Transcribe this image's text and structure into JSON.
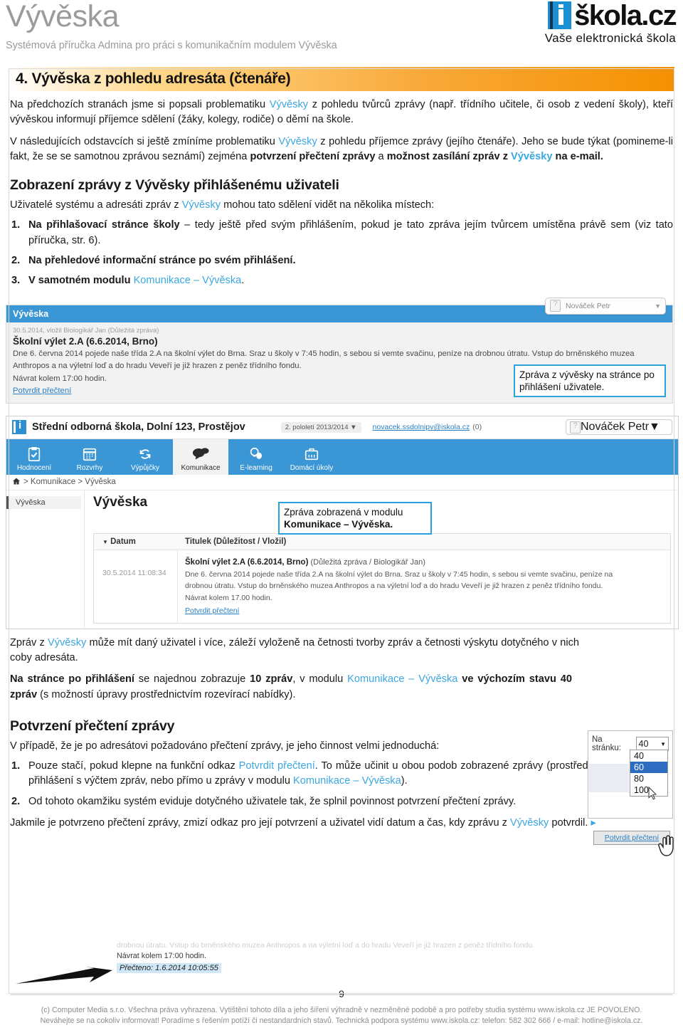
{
  "header": {
    "title": "Vývěska",
    "subtitle": "Systémová příručka Admina pro práci s komunikačním modulem Vývěska",
    "logo_text": "škola.cz",
    "logo_tagline": "Vaše elektronická škola",
    "logo_color": "#1a8fd4"
  },
  "section": {
    "heading": "4. Vývěska z pohledu adresáta (čtenáře)",
    "accent_color": "#f59100"
  },
  "intro": {
    "p1_a": "Na předchozích stranách jsme si popsali problematiku ",
    "p1_link": "Vývěsky",
    "p1_b": " z pohledu tvůrců zprávy (např. třídního učitele, či osob z vedení školy), kteří vývěskou informují příjemce sdělení (žáky, kolegy, rodiče) o děmí na škole.",
    "p2_a": "V následujících odstavcích si ještě zmíníme problematiku ",
    "p2_link": "Vývěsky",
    "p2_b": " z pohledu příjemce zprávy (jejího čtenáře). Jeho se bude týkat (pomineme-li fakt, že se se samotnou zprávou seznámí) zejména ",
    "p2_bold1": "potvrzení přečtení zprávy",
    "p2_c": " a ",
    "p2_bold2": "možnost zasílání zpráv z ",
    "p2_link2": "Vývěsky",
    "p2_bold3": " na e-mail."
  },
  "display_section": {
    "heading": "Zobrazení zprávy z Vývěsky přihlášenému uživateli",
    "lead_a": "Uživatelé systému a adresáti zpráv z ",
    "lead_link": "Vývěsky",
    "lead_b": " mohou tato sdělení vidět na několika místech:",
    "items": [
      {
        "num": "1.",
        "bold": "Na přihlašovací stránce školy",
        "rest": " – tedy ještě před svým přihlášením, pokud je tato zpráva jejím tvůrcem umístěna právě sem (viz tato příručka, str. 6)."
      },
      {
        "num": "2.",
        "bold": "Na přehledové informační stránce po svém přihlášení.",
        "rest": ""
      },
      {
        "num": "3.",
        "bold": "V samotném modulu ",
        "link": "Komunikace – Vývěska",
        "rest": "."
      }
    ]
  },
  "screenshot1": {
    "user_chip": {
      "name": "Nováček Petr",
      "caret": "▼",
      "avatar_icon": "avatar-placeholder-icon"
    },
    "panel_title": "Vývěska",
    "meta": "30.5.2014, vložil Biologikář Jan (Důležitá zpráva)",
    "subject": "Školní výlet 2.A (6.6.2014, Brno)",
    "body_line1": "Dne 6. června 2014 pojede naše třída 2.A na školní výlet do Brna. Sraz u školy v 7:45 hodin, s sebou si vemte svačinu, peníze na drobnou útratu. Vstup do brněnského muzea",
    "body_line2": "Anthropos a na výletní loď a do hradu Veveří je již hrazen z peněz třídního fondu.",
    "body_line3": "Návrat kolem 17:00 hodin.",
    "confirm_link": "Potvrdit přečtení",
    "callout": "Zpráva z vývěsky na stránce po přihlášení uživatele."
  },
  "screenshot2": {
    "school_name": "Střední odborná škola, Dolní 123, Prostějov",
    "term": "2. pololetí 2013/2014",
    "term_caret": "▼",
    "mail": "novacek.ssdolnipv@iskola.cz",
    "mail_count": "(0)",
    "user_chip": {
      "name": "Nováček Petr",
      "caret": "▼"
    },
    "nav": [
      {
        "label": "Hodnocení",
        "icon": "clipboard-check-icon",
        "active": false
      },
      {
        "label": "Rozvrhy",
        "icon": "calendar-icon",
        "active": false
      },
      {
        "label": "Výpůjčky",
        "icon": "refresh-cycle-icon",
        "active": false
      },
      {
        "label": "Komunikace",
        "icon": "speech-bubbles-icon",
        "active": true
      },
      {
        "label": "E-learning",
        "icon": "bulb-mouse-icon",
        "active": false
      },
      {
        "label": "Domácí úkoly",
        "icon": "briefcase-icon",
        "active": false
      }
    ],
    "breadcrumb_home_icon": "home-icon",
    "breadcrumb": "> Komunikace > Vývěska",
    "sidebar_item": "Vývěska",
    "page_title": "Vývěska",
    "table": {
      "col_date": "Datum",
      "col_date_sort_icon": "sort-descending-icon",
      "col_title": "Titulek (Důležitost / Vložil)",
      "rows": [
        {
          "date": "30.5.2014 11:08:34",
          "title": "Školní výlet 2.A (6.6.2014, Brno)",
          "meta": " (Důležitá zpráva / Biologikář Jan)",
          "text_line1": "Dne 6. června 2014 pojede naše třída 2.A na školní výlet do Brna. Sraz u školy v 7:45 hodin, s sebou si vemte svačinu, peníze na",
          "text_line2": "drobnou útratu. Vstup do brněnského muzea Anthropos a na výletní loď a do hradu Veveří je již hrazen z peněz třídního fondu.",
          "text_line3": "Návrat kolem 17.00 hodin.",
          "link": "Potvrdit přečtení"
        }
      ]
    },
    "callout_line1": "Zpráva zobrazená v modulu",
    "callout_line2": "Komunikace – Vývěska."
  },
  "middle_text": {
    "p1_a": "Zpráv z ",
    "p1_link": "Vývěsky",
    "p1_b": " může mít daný uživatel i více, záleží vyloženě na četnosti tvorby zpráv a četnosti výskytu dotyčného v nich coby adresáta.",
    "p2_bold1": "Na stránce po přihlášení",
    "p2_a": " se najednou zobrazuje ",
    "p2_bold2": "10 zpráv",
    "p2_b": ", v modulu ",
    "p2_link": "Komunikace – Vývěska",
    "p2_bold3": " ve výchozím stavu 40 zpráv",
    "p2_c": " (s možností úpravy prostřednictvím rozevírací nabídky)."
  },
  "dropdown_widget": {
    "label": "Na stránku:",
    "selected": "40",
    "caret": "▼",
    "options": [
      "40",
      "60",
      "80",
      "100"
    ],
    "highlighted": "60",
    "cursor_icon": "mouse-cursor-icon"
  },
  "confirm_section": {
    "heading": "Potvrzení přečtení zprávy",
    "lead": "V případě, že je po adresátovi požadováno přečtení zprávy, je jeho činnost velmi jednoduchá:",
    "items": [
      {
        "num": "1.",
        "a": "Pouze stačí, pokud klepne na funkční odkaz ",
        "link1": "Potvrdit přečtení",
        "b": ". To může učinit u obou podob zobrazené zprávy (prostřednictvím stránky po přihlášení s výčtem zpráv, nebo přímo u zprávy v modulu ",
        "link2": "Komunikace – Vývěska",
        "c": ")."
      },
      {
        "num": "2.",
        "a": "Od tohoto okamžiku systém eviduje dotyčného uživatele tak, že splnil povinnost potvrzení přečtení zprávy.",
        "link1": "",
        "b": "",
        "link2": "",
        "c": ""
      }
    ],
    "closing_a": "Jakmile je potvrzeno přečtení zprávy, zmizí odkaz pro její potvrzení a uživatel vidí datum a čas, kdy zprávu z ",
    "closing_link": "Vývěsky",
    "closing_b": " potvrdil. ",
    "closing_marker": "▸"
  },
  "confirm_button_widget": {
    "label": "Potvrdit přečtení",
    "cursor_icon": "hand-pointer-icon"
  },
  "screenshot3": {
    "faded_text": "drobnou útratu. Vstup do brněnského muzea Anthropos a na výletní loď a do hradu Veveří je již hrazen z peněz třídního fondu.",
    "line": "Návrat kolem 17:00 hodin.",
    "read_stamp": "Přečteno: 1.6.2014 10:05:55",
    "arrow_icon": "black-arrow-icon"
  },
  "footer": {
    "page_number": "9",
    "line1": "(c) Computer Media s.r.o. Všechna práva vyhrazena. Vytištění tohoto díla a jeho šíření výhradně v nezměněné podobě a pro potřeby studia systému www.iskola.cz JE POVOLENO.",
    "line2": "Neváhejte se na cokoliv informovat! Poradíme s řešením potíží či nestandardních stavů. Technická podpora systému www.iskola.cz: telefon: 582 302 666 / e-mail: hotline@iskola.cz."
  }
}
